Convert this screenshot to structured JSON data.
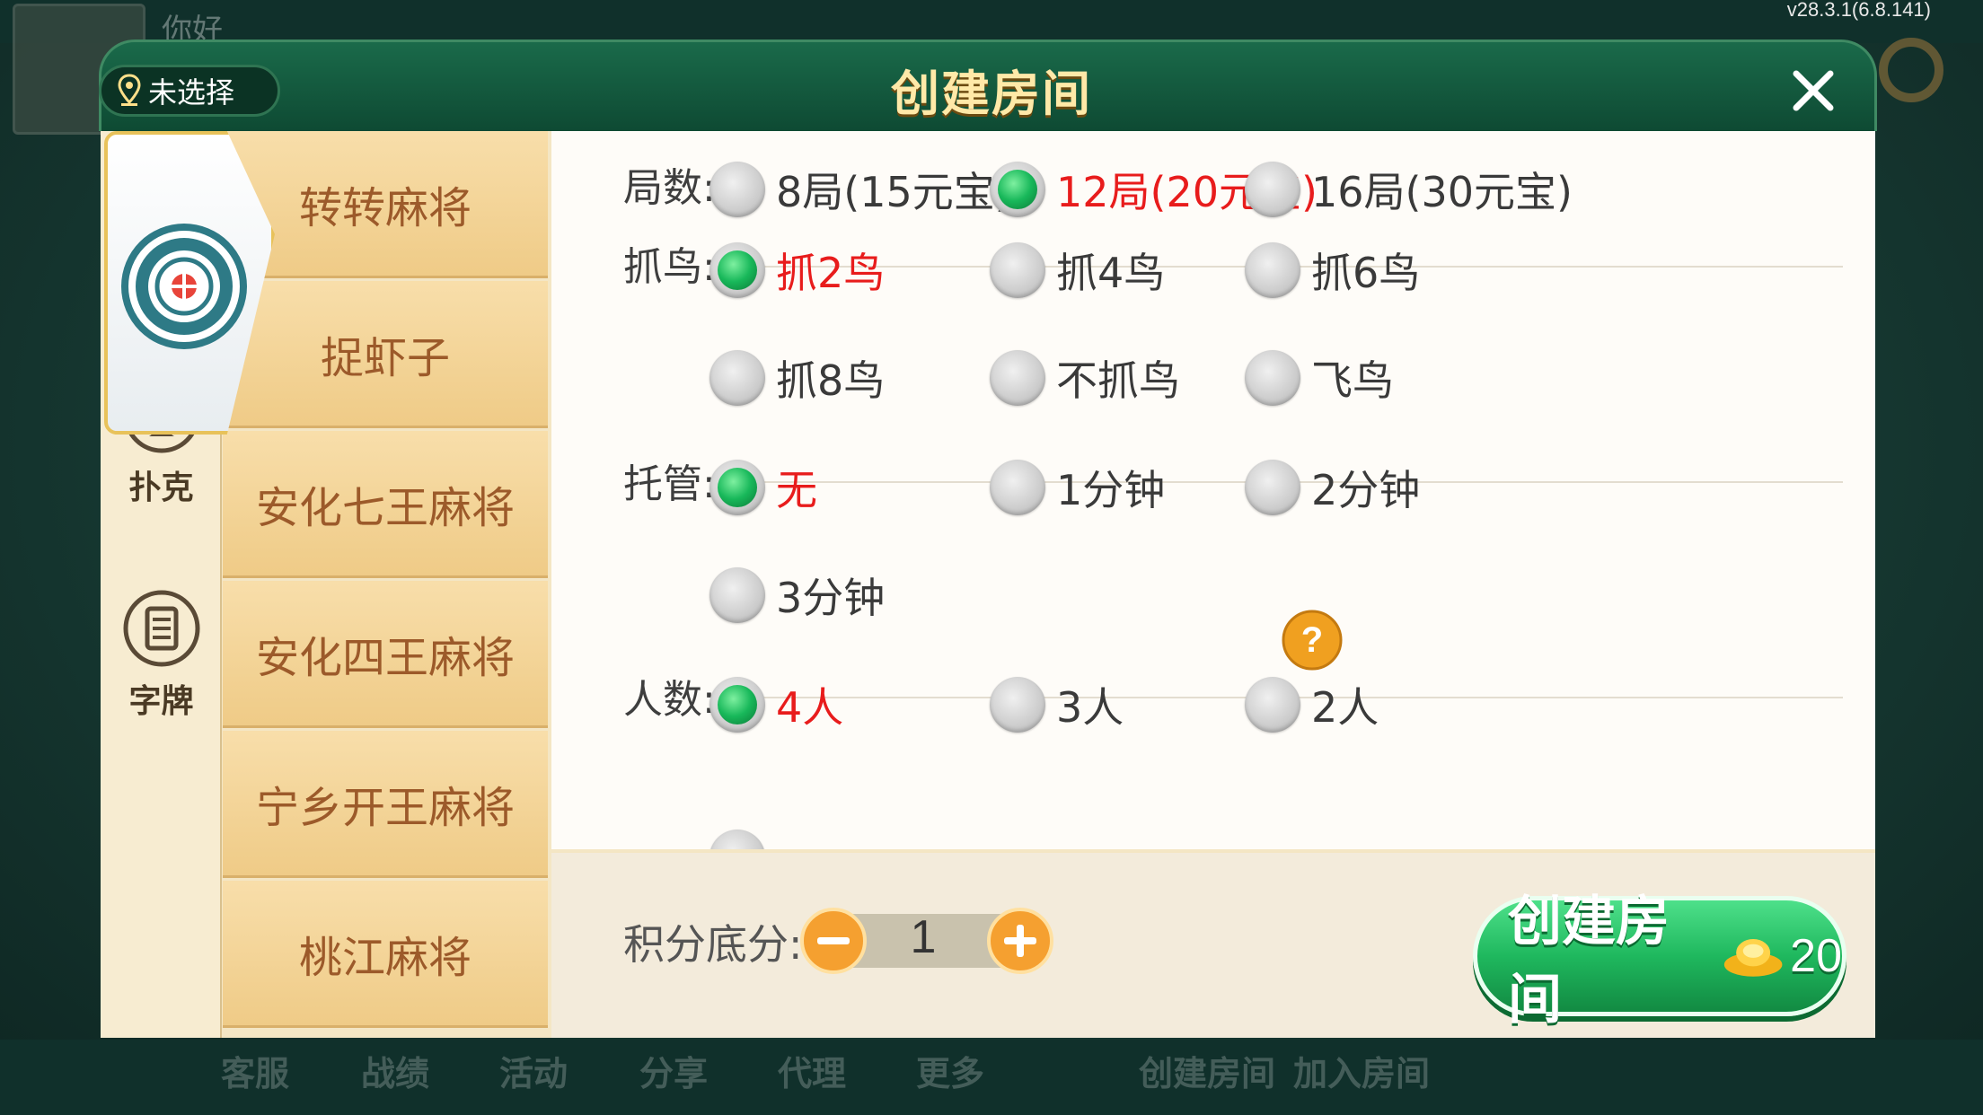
{
  "version": "v28.3.1(6.8.141)",
  "background": {
    "greeting": "你好",
    "bottom_items": [
      "客服",
      "战绩",
      "活动",
      "分享",
      "代理",
      "更多",
      "创建房间",
      "加入房间"
    ]
  },
  "header": {
    "location": "未选择",
    "title": "创建房间"
  },
  "sidebar": {
    "tabs": [
      {
        "label": "",
        "icon": "mahjong-icon",
        "active": true
      },
      {
        "label": "扑克",
        "icon": "spade-icon",
        "active": false
      },
      {
        "label": "字牌",
        "icon": "zipai-icon",
        "active": false
      }
    ]
  },
  "games": [
    "转转麻将",
    "捉虾子",
    "安化七王麻将",
    "安化四王麻将",
    "宁乡开王麻将",
    "桃江麻将"
  ],
  "options": {
    "rounds": {
      "label": "局数:",
      "items": [
        "8局(15元宝)",
        "12局(20元宝)",
        "16局(30元宝)"
      ],
      "selected": 1
    },
    "birds": {
      "label": "抓鸟:",
      "items": [
        "抓2鸟",
        "抓4鸟",
        "抓6鸟",
        "抓8鸟",
        "不抓鸟",
        "飞鸟"
      ],
      "selected": 0
    },
    "hosting": {
      "label": "托管:",
      "items": [
        "无",
        "1分钟",
        "2分钟",
        "3分钟"
      ],
      "selected": 0
    },
    "players": {
      "label": "人数:",
      "items": [
        "4人",
        "3人",
        "2人"
      ],
      "selected": 0
    }
  },
  "footer": {
    "score_label": "积分底分:",
    "score_value": "1",
    "create_label": "创建房间",
    "cost": "20"
  },
  "colors": {
    "selected_text": "#e81c1c",
    "header_green": "#0e4a33",
    "game_item": "#efcb87",
    "create_button": "#1fb85e"
  }
}
